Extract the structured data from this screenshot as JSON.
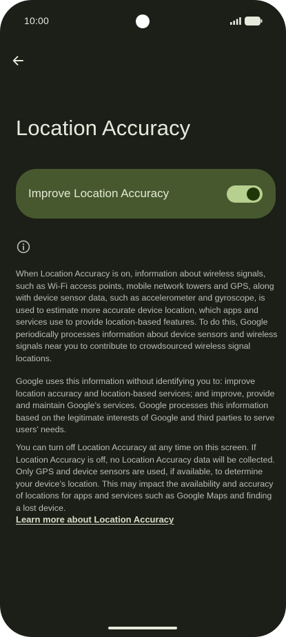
{
  "status_bar": {
    "time": "10:00",
    "icons": [
      "signal-icon",
      "battery-icon"
    ]
  },
  "header": {
    "back_icon": "arrow-left-icon",
    "title": "Location Accuracy"
  },
  "main_switch": {
    "label": "Improve Location Accuracy",
    "state": "on"
  },
  "info": {
    "icon": "info-icon",
    "paragraphs": [
      "When Location Accuracy is on, information about wireless signals, such as Wi-Fi access points, mobile network towers and GPS, along with device sensor data, such as accelerometer and gyroscope, is used to estimate more accurate device location, which apps and services use to provide location-based features. To do this, Google periodically processes information about device sensors and wireless signals near you to contribute to crowdsourced wireless signal locations.",
      "Google uses this information without identifying you to: improve location accuracy and location-based services; and improve, provide and maintain Google’s services. Google processes this information based on the legitimate interests of Google and third parties to serve users’ needs.",
      "You can turn off Location Accuracy at any time on this screen. If Location Accuracy is off, no Location Accuracy data will be collected. Only GPS and device sensors are used, if available, to determine your device’s location. This may impact the availability and accuracy of locations for apps and services such as Google Maps and finding a lost device."
    ],
    "learn_more_link": "Learn more about Location Accuracy"
  },
  "colors": {
    "background": "#1b1f17",
    "card": "#47582f",
    "toggle_track": "#b7d08f",
    "toggle_thumb": "#1f3609",
    "title_text": "#e6e9dc",
    "body_text": "#b9bdb2"
  }
}
